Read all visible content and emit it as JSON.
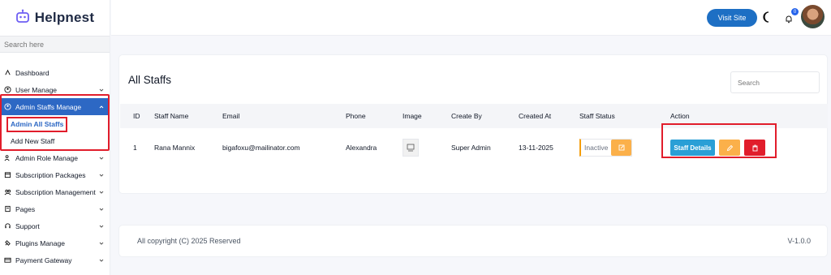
{
  "brand": {
    "name": "Helpnest"
  },
  "sidebar": {
    "search_placeholder": "Search here",
    "items": [
      {
        "label": "Dashboard",
        "icon": "dashboard-icon",
        "chevron": false
      },
      {
        "label": "User Manage",
        "icon": "user-icon",
        "chevron": true
      },
      {
        "label": "Admin Staffs Manage",
        "icon": "user-icon",
        "chevron": true,
        "active": true
      },
      {
        "label": "Admin Role Manage",
        "icon": "role-icon",
        "chevron": true
      },
      {
        "label": "Subscription Packages",
        "icon": "package-icon",
        "chevron": true
      },
      {
        "label": "Subscription Management",
        "icon": "subscription-icon",
        "chevron": true
      },
      {
        "label": "Pages",
        "icon": "pages-icon",
        "chevron": true
      },
      {
        "label": "Support",
        "icon": "support-icon",
        "chevron": true
      },
      {
        "label": "Plugins Manage",
        "icon": "plugin-icon",
        "chevron": true
      },
      {
        "label": "Payment Gateway",
        "icon": "payment-icon",
        "chevron": true
      }
    ],
    "sub_items": [
      {
        "label": "Admin All Staffs",
        "active": true
      },
      {
        "label": "Add New Staff",
        "active": false
      }
    ]
  },
  "topbar": {
    "visit_site": "Visit Site",
    "notification_count": "0"
  },
  "main": {
    "title": "All Staffs",
    "search_placeholder": "Search",
    "columns": [
      "ID",
      "Staff Name",
      "Email",
      "Phone",
      "Image",
      "Create By",
      "Created At",
      "Staff Status",
      "Action"
    ],
    "rows": [
      {
        "id": "1",
        "name": "Rana Mannix",
        "email": "bigafoxu@mailinator.com",
        "phone": "Alexandra",
        "created_by": "Super Admin",
        "created_at": "13-11-2025",
        "status": "Inactive",
        "details_label": "Staff Details"
      }
    ]
  },
  "footer": {
    "copyright": "All copyright (C) 2025 Reserved",
    "version": "V-1.0.0"
  },
  "colors": {
    "primary": "#1d6fc4",
    "sidebar_active": "#2d68c4",
    "highlight_border": "#e11d2b",
    "warning": "#fbb04a",
    "danger": "#e11d2b",
    "info": "#2a9fd6"
  }
}
